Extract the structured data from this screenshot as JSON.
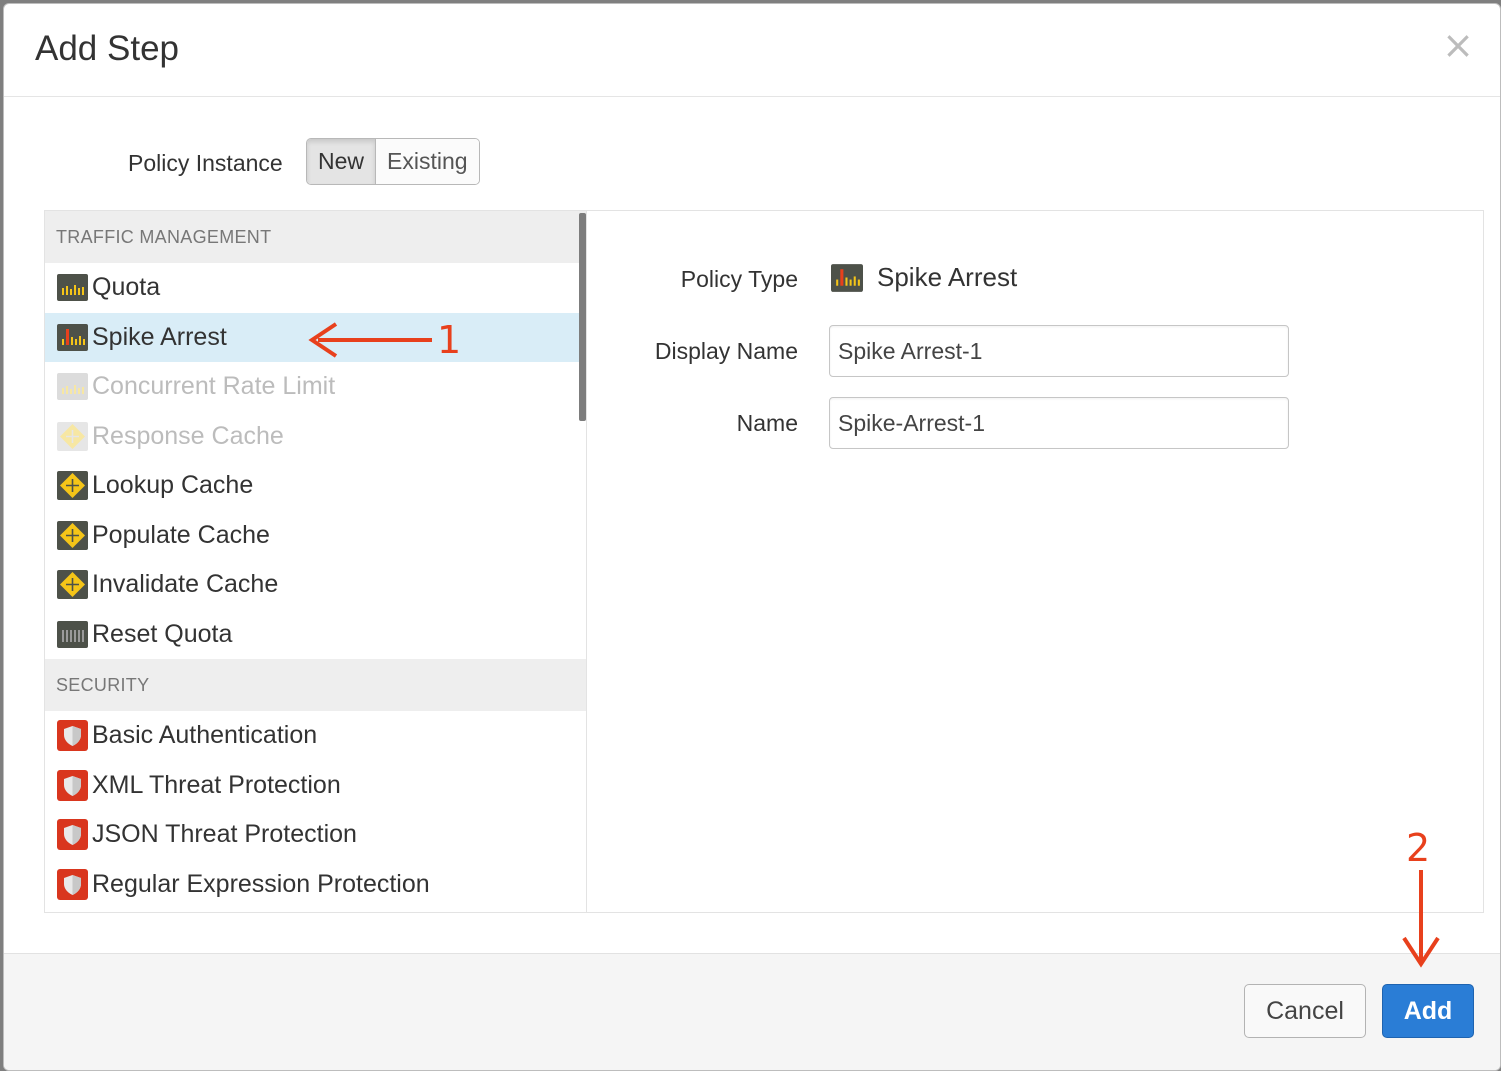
{
  "dialog": {
    "title": "Add Step",
    "close_symbol": "×"
  },
  "policy_instance": {
    "label": "Policy Instance",
    "options": [
      "New",
      "Existing"
    ],
    "selected": "New"
  },
  "policy_list": {
    "sections": [
      {
        "header": "TRAFFIC MANAGEMENT",
        "items": [
          {
            "label": "Quota",
            "icon": "quota-icon"
          },
          {
            "label": "Spike Arrest",
            "icon": "spike-arrest-icon",
            "selected": true
          },
          {
            "label": "Concurrent Rate Limit",
            "icon": "concurrent-rate-limit-icon",
            "disabled": true
          },
          {
            "label": "Response Cache",
            "icon": "cache-icon",
            "disabled": true
          },
          {
            "label": "Lookup Cache",
            "icon": "cache-icon"
          },
          {
            "label": "Populate Cache",
            "icon": "cache-icon"
          },
          {
            "label": "Invalidate Cache",
            "icon": "cache-icon"
          },
          {
            "label": "Reset Quota",
            "icon": "reset-quota-icon"
          }
        ]
      },
      {
        "header": "SECURITY",
        "items": [
          {
            "label": "Basic Authentication",
            "icon": "shield-icon"
          },
          {
            "label": "XML Threat Protection",
            "icon": "shield-icon"
          },
          {
            "label": "JSON Threat Protection",
            "icon": "shield-icon"
          },
          {
            "label": "Regular Expression Protection",
            "icon": "shield-icon"
          }
        ]
      }
    ]
  },
  "form": {
    "policy_type_label": "Policy Type",
    "policy_type_value": "Spike Arrest",
    "display_name_label": "Display Name",
    "display_name_value": "Spike Arrest-1",
    "name_label": "Name",
    "name_value": "Spike-Arrest-1"
  },
  "footer": {
    "cancel_label": "Cancel",
    "add_label": "Add"
  },
  "annotations": {
    "step1": "1",
    "step2": "2"
  },
  "colors": {
    "selected_row": "#d9edf7",
    "primary_button": "#2a7dd6",
    "annotation": "#e8401c",
    "cache_icon": "#f5c518",
    "shield_icon": "#d9361e",
    "quota_icon_bg": "#4d5149"
  }
}
